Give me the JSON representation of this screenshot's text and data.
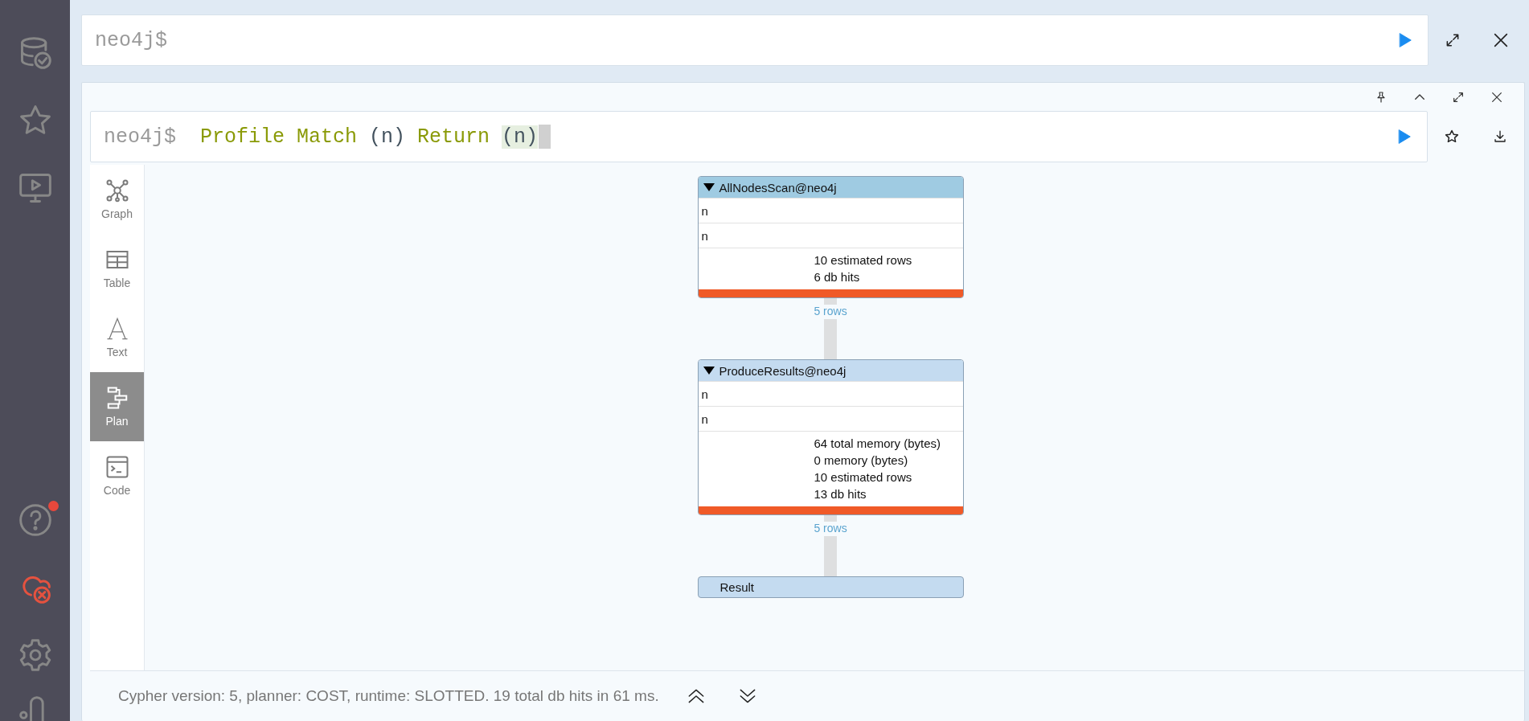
{
  "sidebar": {
    "help_notification": true,
    "connection_error": true
  },
  "editor": {
    "prompt": "neo4j$"
  },
  "frame": {
    "query": {
      "prompt": "neo4j$",
      "cursor": true,
      "tokens": [
        {
          "text": "Profile Match",
          "kind": "keyword"
        },
        {
          "text": "(n)",
          "kind": "plain"
        },
        {
          "text": "Return",
          "kind": "keyword"
        },
        {
          "text": "(n)",
          "kind": "matched"
        }
      ]
    },
    "views": [
      {
        "label": "Graph",
        "selected": false
      },
      {
        "label": "Table",
        "selected": false
      },
      {
        "label": "Text",
        "selected": false
      },
      {
        "label": "Plan",
        "selected": true
      },
      {
        "label": "Code",
        "selected": false
      }
    ],
    "plan": {
      "nodes": [
        {
          "kind": "operator",
          "title": "AllNodesScan@neo4j",
          "expanded": true,
          "color": "#9fcbe2",
          "details": [
            "n",
            "n"
          ],
          "stats": [
            "10 estimated rows",
            "6 db hits"
          ],
          "edge": "5 rows"
        },
        {
          "kind": "operator",
          "title": "ProduceResults@neo4j",
          "expanded": true,
          "color": "#c4dbf0",
          "details": [
            "n",
            "n"
          ],
          "stats": [
            "64 total memory (bytes)",
            "0 memory (bytes)",
            "10 estimated rows",
            "13 db hits"
          ],
          "edge": "5 rows"
        },
        {
          "kind": "result",
          "title": "Result",
          "color": "#c4dbf0"
        }
      ]
    },
    "summary": "Cypher version: 5, planner: COST, runtime: SLOTTED. 19 total db hits in 61 ms."
  }
}
